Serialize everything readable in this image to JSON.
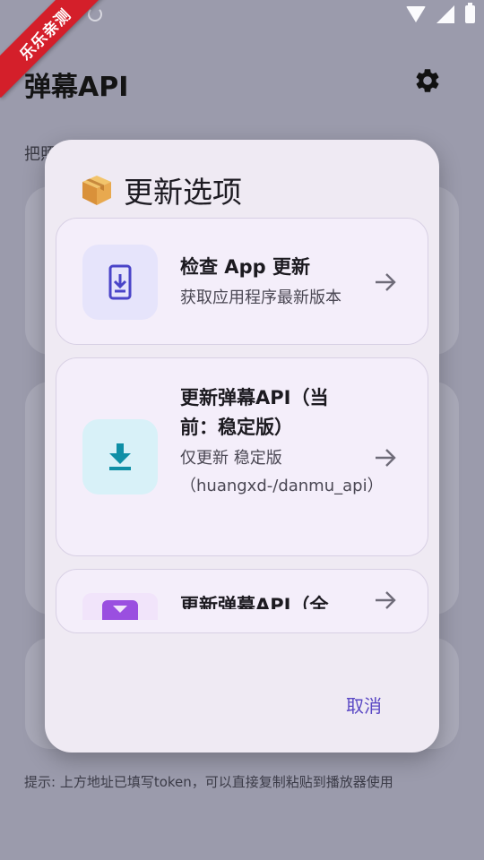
{
  "status_bar": {
    "icons": [
      "notification-icon",
      "sync-icon",
      "wifi-icon",
      "signal-icon",
      "battery-icon"
    ]
  },
  "watermark": {
    "text": "乐乐亲测"
  },
  "app": {
    "title": "弹幕API",
    "hint_partial": "把照",
    "footer_tip": "提示: 上方地址已填写token，可以直接复制粘贴到播放器使用"
  },
  "dialog": {
    "title_icon": "package-emoji",
    "title": "更新选项",
    "options": [
      {
        "title": "检查 App 更新",
        "desc": "获取应用程序最新版本",
        "icon": "phone-download-icon",
        "icon_color": "#4a44c8",
        "icon_bg": "#e6e4fb"
      },
      {
        "title": "更新弹幕API（当前：稳定版）",
        "desc": "仅更新 稳定版（huangxd-/danmu_api）",
        "icon": "download-icon",
        "icon_color": "#0f8fa6",
        "icon_bg": "#d8f1f8"
      },
      {
        "title": "更新弹幕API（全",
        "icon": "download-box-icon",
        "icon_color": "#9a4fe0",
        "icon_bg": "#f1e4fa"
      }
    ],
    "cancel_label": "取消"
  },
  "colors": {
    "accent": "#5a48c4",
    "scrim": "#9b9bac",
    "dialog_bg": "#efeaf3"
  }
}
